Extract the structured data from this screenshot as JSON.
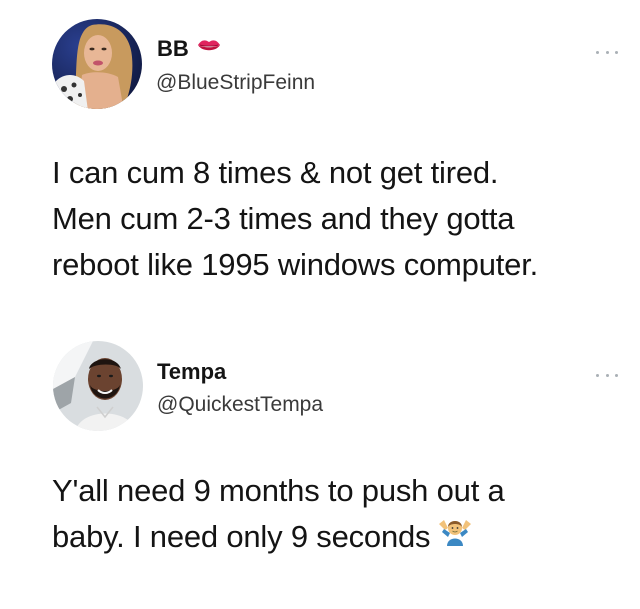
{
  "tweets": [
    {
      "display_name": "BB",
      "name_emoji": "lips-icon",
      "handle": "@BlueStripFeinn",
      "body_lines": [
        "I can cum 8 times & not get tired.",
        "Men cum 2-3 times and they gotta",
        "reboot like 1995 windows computer."
      ]
    },
    {
      "display_name": "Tempa",
      "handle": "@QuickestTempa",
      "body_lines": [
        "Y'all need 9 months to push out a",
        "baby. I need only 9 seconds"
      ],
      "trailing_emoji": "person-shrugging-icon"
    }
  ],
  "colors": {
    "text": "#141414",
    "handle": "#3a3a3a",
    "more_dots": "#aab0b6",
    "background": "#ffffff"
  }
}
